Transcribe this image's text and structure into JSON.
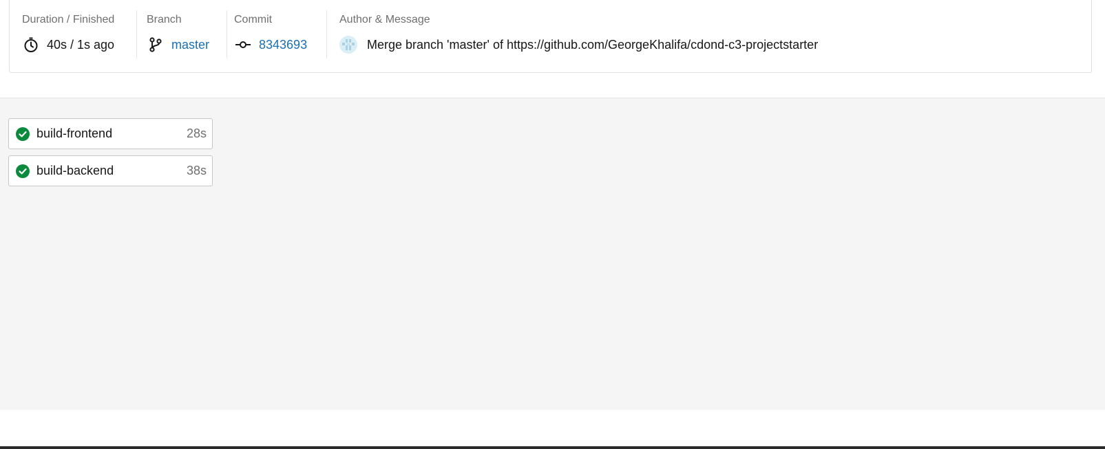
{
  "summary": {
    "duration": {
      "label": "Duration / Finished",
      "value": "40s / 1s ago",
      "icon": "stopwatch-icon"
    },
    "branch": {
      "label": "Branch",
      "value": "master",
      "icon": "branch-icon"
    },
    "commit": {
      "label": "Commit",
      "value": "8343693",
      "icon": "commit-icon"
    },
    "author": {
      "label": "Author & Message",
      "message": "Merge branch 'master' of https://github.com/GeorgeKhalifa/cdond-c3-projectstarter",
      "icon": "avatar-icon"
    }
  },
  "jobs": [
    {
      "name": "build-frontend",
      "duration": "28s",
      "status": "success"
    },
    {
      "name": "build-backend",
      "duration": "38s",
      "status": "success"
    }
  ],
  "colors": {
    "success": "#0a8a3c",
    "link": "#1a6fb5",
    "workflow_bg": "#f5f5f5"
  }
}
